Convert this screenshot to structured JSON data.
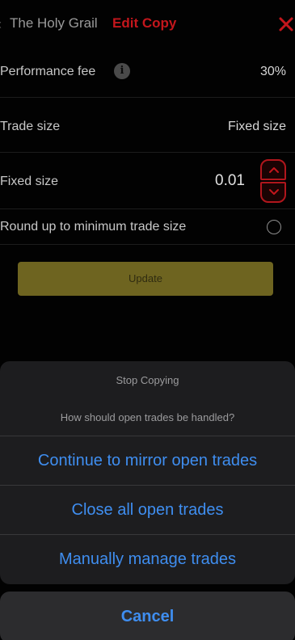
{
  "header": {
    "title": "The Holy Grail",
    "subtitle": "Edit Copy"
  },
  "settings": {
    "performance_fee": {
      "label": "Performance fee",
      "value": "30%"
    },
    "trade_size": {
      "label": "Trade size",
      "value": "Fixed size"
    },
    "fixed_size": {
      "label": "Fixed size",
      "value": "0.01"
    },
    "round_up": {
      "label": "Round up to minimum trade size",
      "checked": false
    }
  },
  "update_label": "Update",
  "action_sheet": {
    "title": "Stop Copying",
    "message": "How should open trades be handled?",
    "actions": [
      {
        "label": "Continue to mirror open trades"
      },
      {
        "label": "Close all open trades"
      },
      {
        "label": "Manually manage trades"
      }
    ],
    "cancel_label": "Cancel"
  },
  "colors": {
    "accent_red": "#c4161c",
    "gold": "#6e6420",
    "action_blue": "#3f8ef0",
    "background": "#020202"
  },
  "icons": {
    "back": "chevron-left-icon",
    "close": "close-icon",
    "info": "info-icon",
    "step_up": "chevron-up-icon",
    "step_down": "chevron-down-icon",
    "radio": "radio-icon"
  }
}
